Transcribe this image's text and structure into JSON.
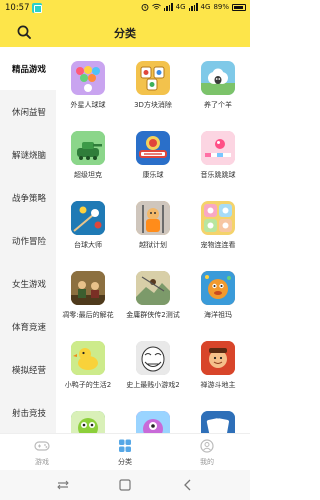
{
  "status": {
    "time": "10:57",
    "network1": "4G",
    "network2": "4G",
    "battery": "89%"
  },
  "header": {
    "title": "分类"
  },
  "sidebar": {
    "items": [
      {
        "label": "精品游戏",
        "active": true
      },
      {
        "label": "休闲益智",
        "active": false
      },
      {
        "label": "解谜烧脑",
        "active": false
      },
      {
        "label": "战争策略",
        "active": false
      },
      {
        "label": "动作冒险",
        "active": false
      },
      {
        "label": "女生游戏",
        "active": false
      },
      {
        "label": "体育竞速",
        "active": false
      },
      {
        "label": "模拟经营",
        "active": false
      },
      {
        "label": "射击竞技",
        "active": false
      }
    ]
  },
  "games": [
    {
      "name": "外星人球球",
      "icon": "bubble-shooter-icon",
      "color": "#c9a4f0"
    },
    {
      "name": "3D方块消除",
      "icon": "mahjong-tiles-icon",
      "color": "#f3c24c"
    },
    {
      "name": "养了个羊",
      "icon": "sheep-icon",
      "color": "#7fc9e8"
    },
    {
      "name": "超级坦克",
      "icon": "tank-icon",
      "color": "#62c56e"
    },
    {
      "name": "康乐球",
      "icon": "carrom-icon",
      "color": "#2a6fc9"
    },
    {
      "name": "音乐跳跳球",
      "icon": "music-ball-icon",
      "color": "#f5b6c8"
    },
    {
      "name": "台球大师",
      "icon": "billiards-icon",
      "color": "#1b5f8f"
    },
    {
      "name": "越狱计划",
      "icon": "prison-escape-icon",
      "color": "#e1a13f"
    },
    {
      "name": "宠物连连看",
      "icon": "pet-match-icon",
      "color": "#f4d36b"
    },
    {
      "name": "凋零:最后的解花",
      "icon": "forest-hunter-icon",
      "color": "#7a5d34"
    },
    {
      "name": "金庸群侠传2测试",
      "icon": "swordsman-icon",
      "color": "#b7a36e"
    },
    {
      "name": "海洋祖玛",
      "icon": "ocean-zuma-icon",
      "color": "#e8742a"
    },
    {
      "name": "小鸭子的生活2",
      "icon": "duck-icon",
      "color": "#9bd05a"
    },
    {
      "name": "史上最贱小游戏2",
      "icon": "troll-face-icon",
      "color": "#c8c8c8"
    },
    {
      "name": "禅游斗地主",
      "icon": "landlord-icon",
      "color": "#e25a3a"
    },
    {
      "name": "",
      "icon": "green-alien-icon",
      "color": "#3fa85a"
    },
    {
      "name": "",
      "icon": "monster-icon",
      "color": "#d85ad6"
    },
    {
      "name": "",
      "icon": "cards-icon",
      "color": "#4aa4e8"
    }
  ],
  "tabs": [
    {
      "label": "游戏",
      "active": false
    },
    {
      "label": "分类",
      "active": true
    },
    {
      "label": "我的",
      "active": false
    }
  ]
}
